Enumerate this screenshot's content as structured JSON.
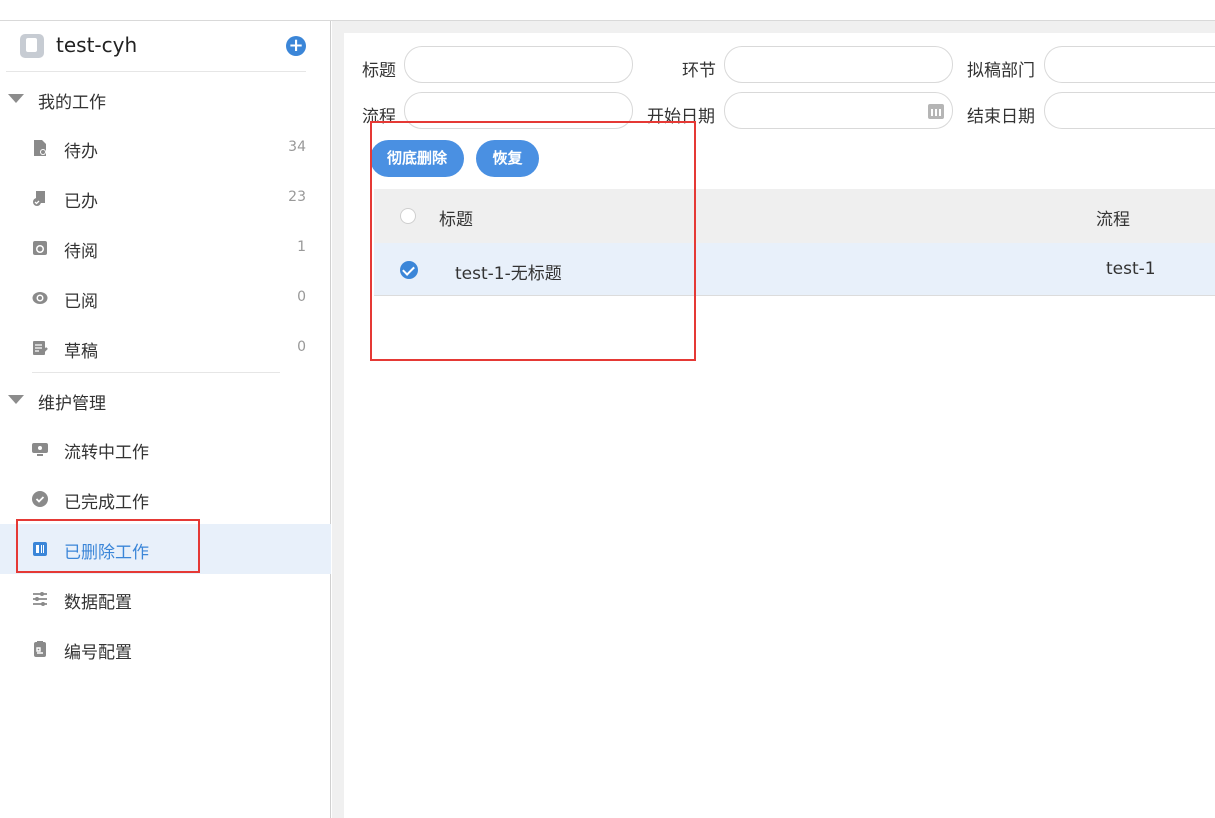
{
  "sidebar": {
    "app_name": "test-cyh",
    "groups": [
      {
        "label": "我的工作",
        "items": [
          {
            "label": "待办",
            "count": "34",
            "icon": "todo-icon"
          },
          {
            "label": "已办",
            "count": "23",
            "icon": "done-icon"
          },
          {
            "label": "待阅",
            "count": "1",
            "icon": "to-read-icon"
          },
          {
            "label": "已阅",
            "count": "0",
            "icon": "read-icon"
          },
          {
            "label": "草稿",
            "count": "0",
            "icon": "draft-icon"
          }
        ]
      },
      {
        "label": "维护管理",
        "items": [
          {
            "label": "流转中工作",
            "icon": "monitor-icon"
          },
          {
            "label": "已完成工作",
            "icon": "check-circle-icon"
          },
          {
            "label": "已删除工作",
            "icon": "delete-doc-icon",
            "active": true
          },
          {
            "label": "数据配置",
            "icon": "sliders-icon"
          },
          {
            "label": "编号配置",
            "icon": "clipboard-icon"
          }
        ]
      }
    ]
  },
  "filters": {
    "title": "标题",
    "node": "环节",
    "dept": "拟稿部门",
    "process": "流程",
    "start_date": "开始日期",
    "end_date": "结束日期"
  },
  "actions": {
    "purge": "彻底删除",
    "restore": "恢复"
  },
  "table": {
    "columns": [
      "标题",
      "流程"
    ],
    "rows": [
      {
        "title": "test-1-无标题",
        "process": "test-1",
        "selected": true
      }
    ]
  },
  "colors": {
    "accent": "#3b86d8",
    "button": "#4a90e2",
    "highlight": "#e53935",
    "active_bg": "#e8f0fa"
  }
}
